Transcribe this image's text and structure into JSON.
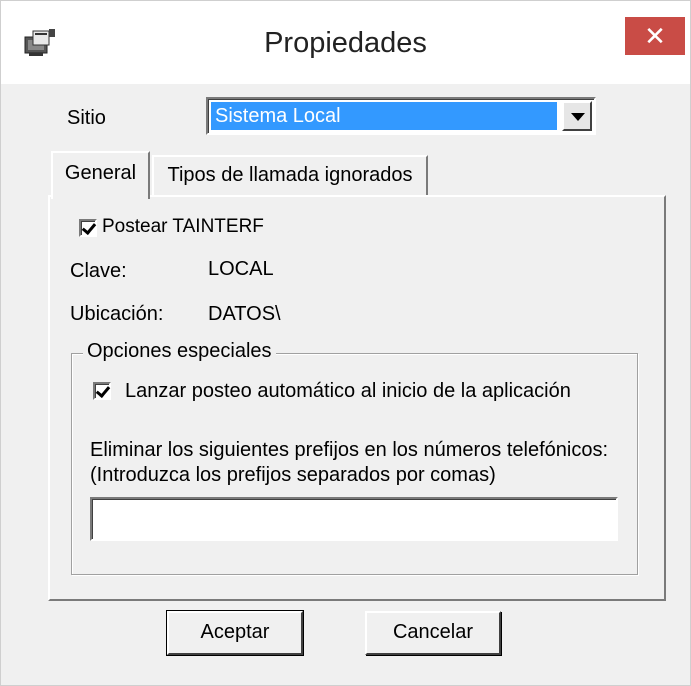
{
  "window": {
    "title": "Propiedades",
    "icon": "properties-computer-icon",
    "close_label": "✕"
  },
  "site": {
    "label": "Sitio",
    "selected_value": "Sistema Local"
  },
  "tabs": [
    {
      "label": "General",
      "active": true
    },
    {
      "label": "Tipos de llamada ignorados",
      "active": false
    }
  ],
  "general": {
    "post_checkbox": {
      "label": "Postear TAINTERF",
      "checked": true
    },
    "key_label": "Clave:",
    "key_value": "LOCAL",
    "location_label": "Ubicación:",
    "location_value": "DATOS\\"
  },
  "special_options": {
    "legend": "Opciones especiales",
    "autopost_checkbox": {
      "label": "Lanzar posteo automático al inicio de la aplicación",
      "checked": true
    },
    "prefix_line1": "Eliminar los siguientes prefijos en los números telefónicos:",
    "prefix_line2": "(Introduzca los prefijos separados por comas)",
    "prefix_value": ""
  },
  "buttons": {
    "accept_label": "Aceptar",
    "cancel_label": "Cancelar"
  },
  "colors": {
    "selection": "#3399ff",
    "close_button": "#c94c46",
    "dialog_bg": "#f0f0f0"
  }
}
